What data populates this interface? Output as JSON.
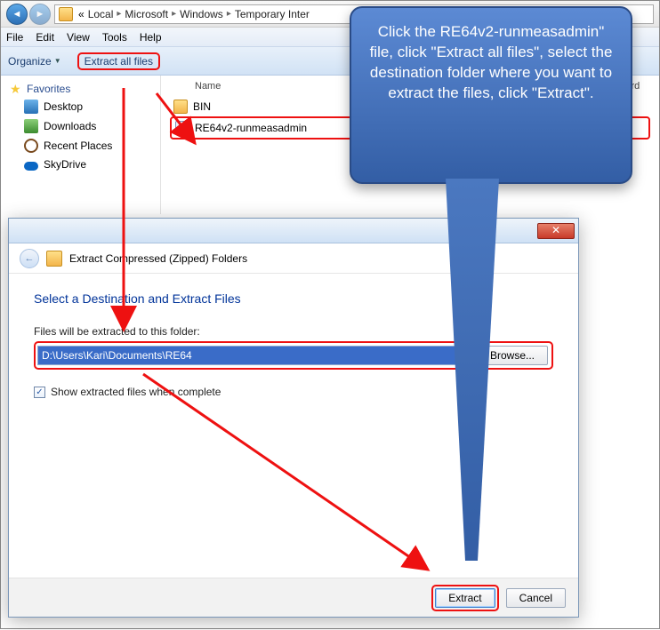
{
  "explorer": {
    "breadcrumbs": [
      "Local",
      "Microsoft",
      "Windows",
      "Temporary Inter"
    ],
    "menu": {
      "file": "File",
      "edit": "Edit",
      "view": "View",
      "tools": "Tools",
      "help": "Help"
    },
    "toolbar": {
      "organize": "Organize",
      "extract_all": "Extract all files"
    },
    "sidebar": {
      "favorites": "Favorites",
      "items": [
        {
          "label": "Desktop"
        },
        {
          "label": "Downloads"
        },
        {
          "label": "Recent Places"
        },
        {
          "label": "SkyDrive"
        }
      ]
    },
    "filepane": {
      "name_header": "Name",
      "password_header": "Password",
      "rows": [
        {
          "label": "BIN"
        },
        {
          "label": "RE64v2-runmeasadmin"
        }
      ]
    }
  },
  "dialog": {
    "title": "Extract Compressed (Zipped) Folders",
    "heading": "Select a Destination and Extract Files",
    "path_label": "Files will be extracted to this folder:",
    "path_value": "D:\\Users\\Kari\\Documents\\RE64",
    "browse": "Browse...",
    "show_extracted": "Show extracted files when complete",
    "extract": "Extract",
    "cancel": "Cancel"
  },
  "callout": {
    "text": "Click the RE64v2-runmeasadmin\" file, click \"Extract all files\", select the destination folder where you want to extract the files, click \"Extract\"."
  }
}
